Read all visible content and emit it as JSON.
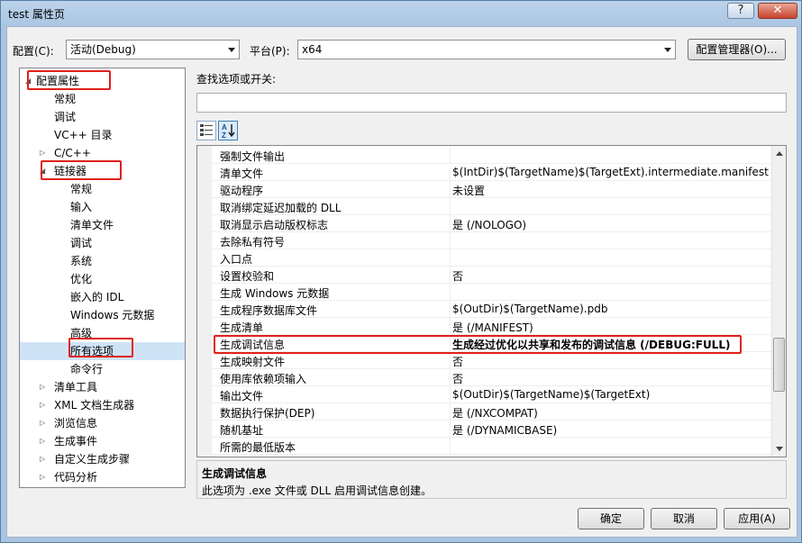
{
  "window": {
    "title": "test 属性页",
    "help_label": "?",
    "close_label": "✕"
  },
  "toolbar": {
    "config_label": "配置(C):",
    "config_value": "活动(Debug)",
    "platform_label": "平台(P):",
    "platform_value": "x64",
    "config_manager_label": "配置管理器(O)..."
  },
  "tree": {
    "items": [
      {
        "label": "配置属性",
        "expander": "◢"
      },
      {
        "label": "常规"
      },
      {
        "label": "调试"
      },
      {
        "label": "VC++ 目录"
      },
      {
        "label": "C/C++",
        "expander": "▷"
      },
      {
        "label": "链接器",
        "expander": "◢"
      },
      {
        "label": "常规"
      },
      {
        "label": "输入"
      },
      {
        "label": "清单文件"
      },
      {
        "label": "调试"
      },
      {
        "label": "系统"
      },
      {
        "label": "优化"
      },
      {
        "label": "嵌入的 IDL"
      },
      {
        "label": "Windows 元数据"
      },
      {
        "label": "高级"
      },
      {
        "label": "所有选项"
      },
      {
        "label": "命令行"
      },
      {
        "label": "清单工具",
        "expander": "▷"
      },
      {
        "label": "XML 文档生成器",
        "expander": "▷"
      },
      {
        "label": "浏览信息",
        "expander": "▷"
      },
      {
        "label": "生成事件",
        "expander": "▷"
      },
      {
        "label": "自定义生成步骤",
        "expander": "▷"
      },
      {
        "label": "代码分析",
        "expander": "▷"
      }
    ]
  },
  "search": {
    "label": "查找选项或开关:",
    "value": ""
  },
  "view_buttons": {
    "categorized_icon": "categorized-icon",
    "alphabetical_icon": "sort-az-icon"
  },
  "grid": {
    "rows": [
      {
        "name": "强制文件输出",
        "value": ""
      },
      {
        "name": "清单文件",
        "value": "$(IntDir)$(TargetName)$(TargetExt).intermediate.manifest"
      },
      {
        "name": "驱动程序",
        "value": "未设置"
      },
      {
        "name": "取消绑定延迟加载的 DLL",
        "value": ""
      },
      {
        "name": "取消显示启动版权标志",
        "value": "是 (/NOLOGO)"
      },
      {
        "name": "去除私有符号",
        "value": ""
      },
      {
        "name": "入口点",
        "value": ""
      },
      {
        "name": "设置校验和",
        "value": "否"
      },
      {
        "name": "生成 Windows 元数据",
        "value": ""
      },
      {
        "name": "生成程序数据库文件",
        "value": "$(OutDir)$(TargetName).pdb"
      },
      {
        "name": "生成清单",
        "value": "是 (/MANIFEST)"
      },
      {
        "name": "生成调试信息",
        "value": "生成经过优化以共享和发布的调试信息 (/DEBUG:FULL)"
      },
      {
        "name": "生成映射文件",
        "value": "否"
      },
      {
        "name": "使用库依赖项输入",
        "value": "否"
      },
      {
        "name": "输出文件",
        "value": "$(OutDir)$(TargetName)$(TargetExt)"
      },
      {
        "name": "数据执行保护(DEP)",
        "value": "是 (/NXCOMPAT)"
      },
      {
        "name": "随机基址",
        "value": "是 (/DYNAMICBASE)"
      },
      {
        "name": "所需的最低版本",
        "value": ""
      }
    ]
  },
  "description": {
    "title": "生成调试信息",
    "text": "此选项为 .exe 文件或 DLL 启用调试信息创建。"
  },
  "buttons": {
    "ok": "确定",
    "cancel": "取消",
    "apply": "应用(A)"
  },
  "colors": {
    "highlight_box": "#e1201b",
    "selection": "#cfe3f7"
  }
}
